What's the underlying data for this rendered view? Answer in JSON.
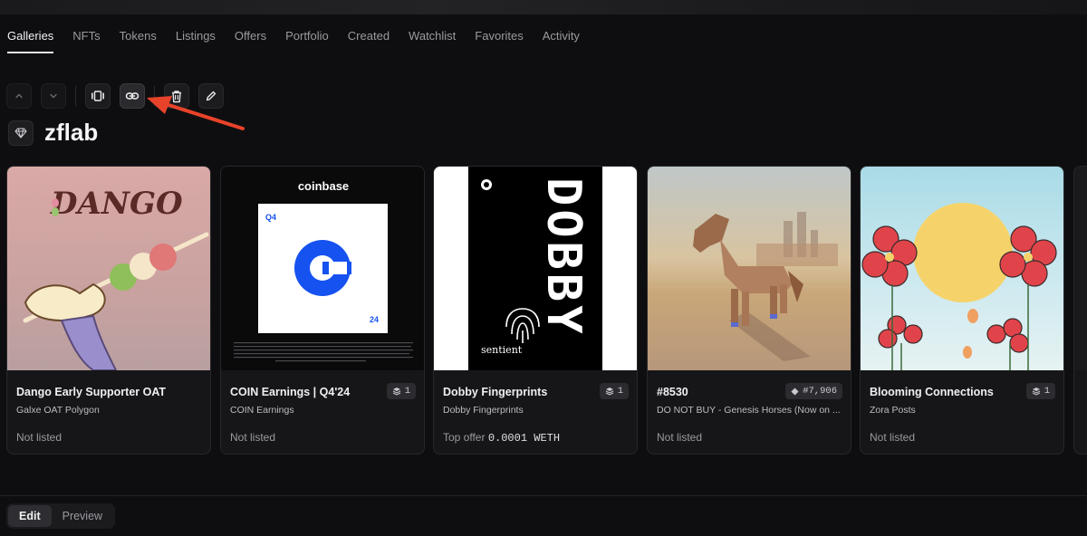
{
  "tabs": [
    "Galleries",
    "NFTs",
    "Tokens",
    "Listings",
    "Offers",
    "Portfolio",
    "Created",
    "Watchlist",
    "Favorites",
    "Activity"
  ],
  "active_tab": "Galleries",
  "toolbar": {
    "icons": [
      "chevron-up-icon",
      "chevron-down-icon",
      "carousel-icon",
      "link-icon",
      "trash-icon",
      "pencil-icon"
    ]
  },
  "gallery": {
    "title": "zflab"
  },
  "cards": [
    {
      "title": "Dango Early Supporter OAT",
      "subtitle": "Galxe OAT Polygon",
      "status": "Not listed",
      "badge": "",
      "image_text": "DANGO"
    },
    {
      "title": "COIN Earnings | Q4'24",
      "subtitle": "COIN Earnings",
      "status": "Not listed",
      "badge": "1",
      "image_text": "coinbase",
      "q_label": "Q4",
      "y_label": "24"
    },
    {
      "title": "Dobby Fingerprints",
      "subtitle": "Dobby Fingerprints",
      "status_prefix": "Top offer",
      "status_value": "0.0001 WETH",
      "badge": "1",
      "image_text": "DOBBY",
      "image_sub": "sentient"
    },
    {
      "title": "#8530",
      "subtitle": "DO NOT BUY - Genesis Horses (Now on ...",
      "status": "Not listed",
      "badge": "#7,906"
    },
    {
      "title": "Blooming Connections",
      "subtitle": "Zora Posts",
      "status": "Not listed",
      "badge": "1"
    }
  ],
  "footer": {
    "edit_label": "Edit",
    "preview_label": "Preview",
    "active": "Edit"
  },
  "colors": {
    "accent_arrow": "#e8432a",
    "coin_blue": "#1652f0"
  }
}
